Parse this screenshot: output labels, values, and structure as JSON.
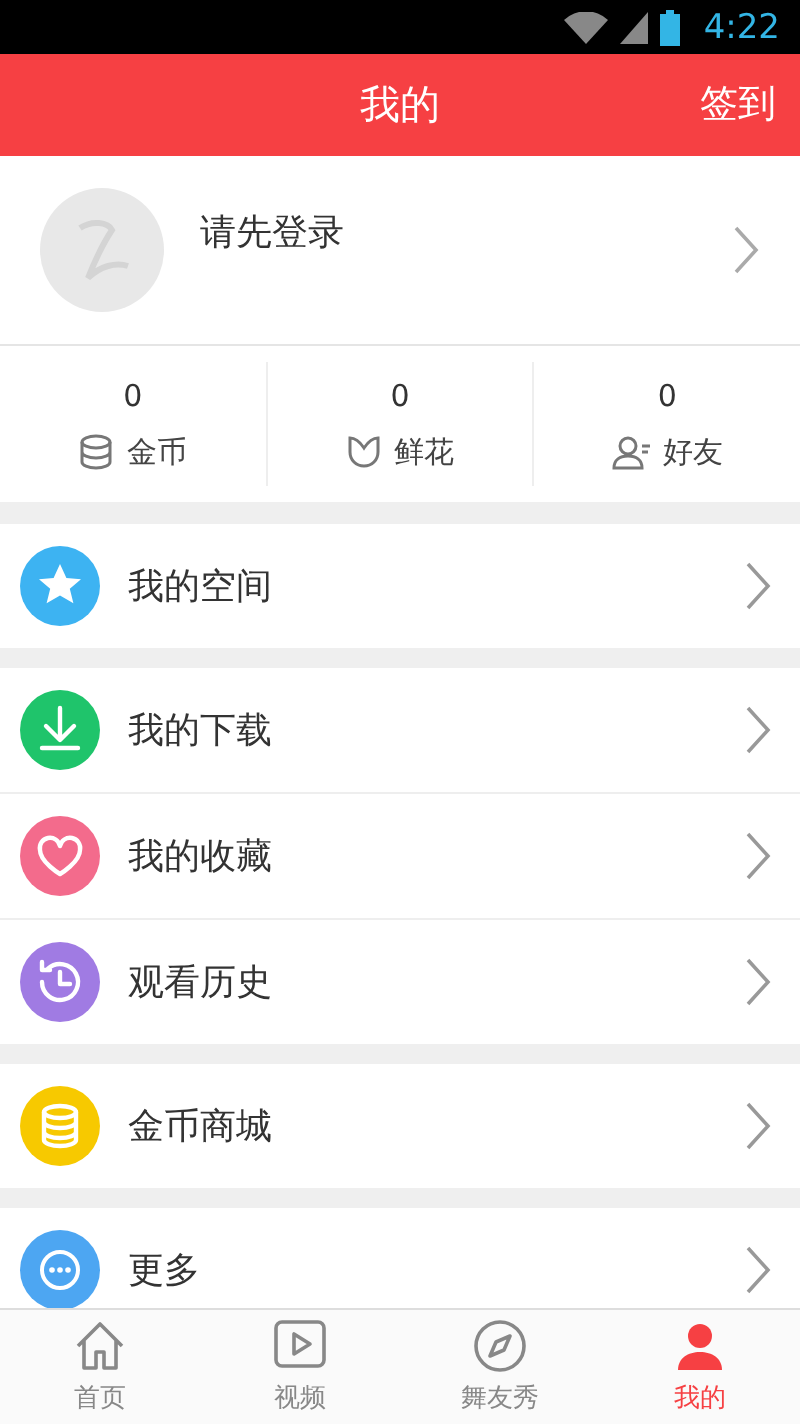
{
  "status_bar": {
    "time": "4:22"
  },
  "header": {
    "title": "我的",
    "action": "签到"
  },
  "profile": {
    "name": "请先登录"
  },
  "stats": [
    {
      "kind": "coins",
      "value": "0",
      "label": "金币"
    },
    {
      "kind": "flower",
      "value": "0",
      "label": "鲜花"
    },
    {
      "kind": "friends",
      "value": "0",
      "label": "好友"
    }
  ],
  "menu_groups": [
    [
      {
        "kind": "star",
        "label": "我的空间",
        "color": "#3db3f2"
      }
    ],
    [
      {
        "kind": "download",
        "label": "我的下载",
        "color": "#1fc46b"
      },
      {
        "kind": "heart",
        "label": "我的收藏",
        "color": "#f36b8c"
      },
      {
        "kind": "history",
        "label": "观看历史",
        "color": "#a07be3"
      }
    ],
    [
      {
        "kind": "coins",
        "label": "金币商城",
        "color": "#f7c900"
      }
    ],
    [
      {
        "kind": "more",
        "label": "更多",
        "color": "#4da6f2"
      }
    ]
  ],
  "tab_bar": [
    {
      "kind": "home",
      "label": "首页",
      "selected": false
    },
    {
      "kind": "video",
      "label": "视频",
      "selected": false
    },
    {
      "kind": "compass",
      "label": "舞友秀",
      "selected": false
    },
    {
      "kind": "person",
      "label": "我的",
      "selected": true
    }
  ]
}
